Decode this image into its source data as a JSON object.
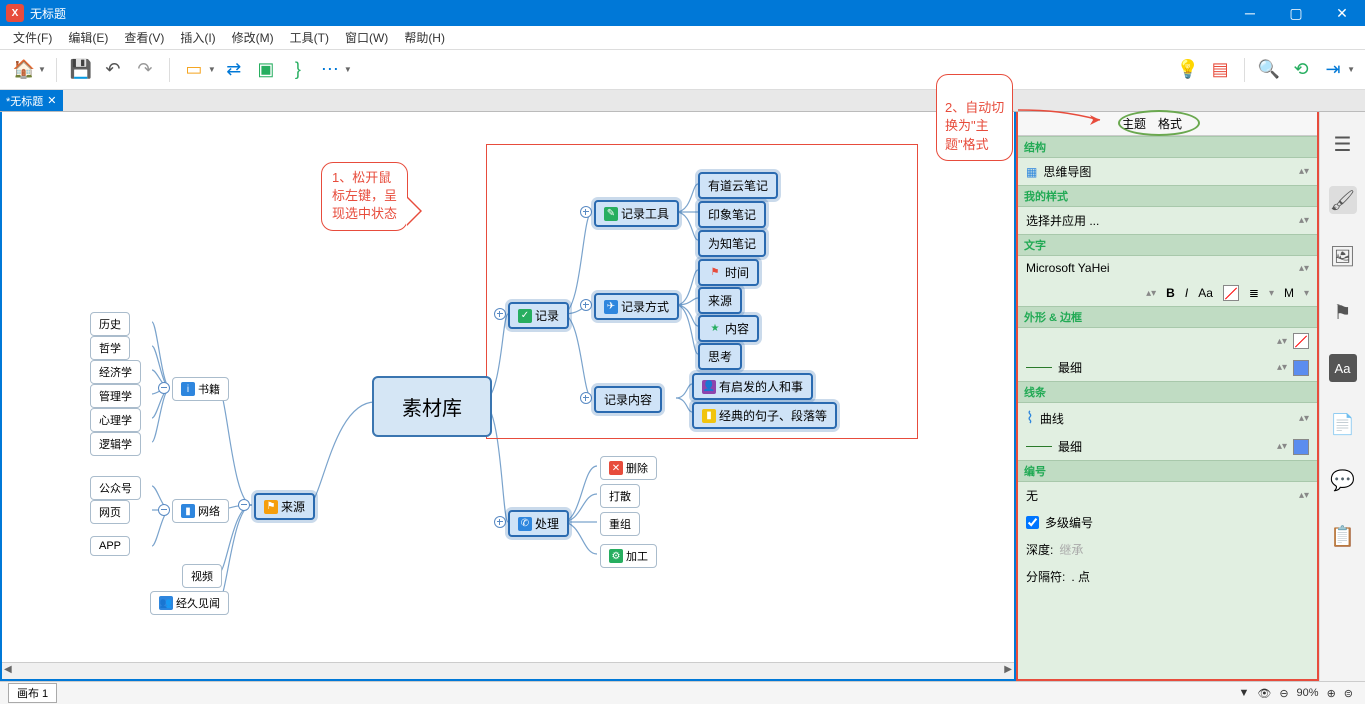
{
  "title": "无标题",
  "menus": [
    "文件(F)",
    "编辑(E)",
    "查看(V)",
    "插入(I)",
    "修改(M)",
    "工具(T)",
    "窗口(W)",
    "帮助(H)"
  ],
  "tab": {
    "label": "*无标题",
    "close": "✕"
  },
  "callout1": "1、松开鼠\n标左键，呈\n现选中状态",
  "callout2": "2、自动切\n换为\"主\n题\"格式",
  "nodes": {
    "root": "素材库",
    "书籍": "书籍",
    "网络": "网络",
    "视频": "视频",
    "经久见闻": "经久见闻",
    "历史": "历史",
    "哲学": "哲学",
    "经济学": "经济学",
    "管理学": "管理学",
    "心理学": "心理学",
    "逻辑学": "逻辑学",
    "公众号": "公众号",
    "网页": "网页",
    "APP": "APP",
    "来源": "来源",
    "记录": "记录",
    "处理": "处理",
    "记录工具": "记录工具",
    "记录方式": "记录方式",
    "记录内容": "记录内容",
    "有道云笔记": "有道云笔记",
    "印象笔记": "印象笔记",
    "为知笔记": "为知笔记",
    "时间": "时间",
    "来源2": "来源",
    "内容": "内容",
    "思考": "思考",
    "有启发的人和事": "有启发的人和事",
    "经典的句子": "经典的句子、段落等",
    "删除": "删除",
    "打散": "打散",
    "重组": "重组",
    "加工": "加工"
  },
  "status": {
    "sheet": "画布 1",
    "zoom": "90%"
  },
  "panel": {
    "tab1": "主题",
    "tab2": "格式",
    "sec_struct": "结构",
    "struct_val": "思维导图",
    "sec_style": "我的样式",
    "style_val": "选择并应用 ...",
    "sec_text": "文字",
    "font": "Microsoft YaHei",
    "sec_shape": "外形 & 边框",
    "shape_thin": "最细",
    "sec_line": "线条",
    "line_curve": "曲线",
    "line_thin": "最细",
    "sec_num": "编号",
    "num_none": "无",
    "num_multi": "多级编号",
    "num_depth_label": "深度:",
    "num_depth_val": "继承",
    "num_sep_label": "分隔符:",
    "num_sep_val": ". 点"
  }
}
